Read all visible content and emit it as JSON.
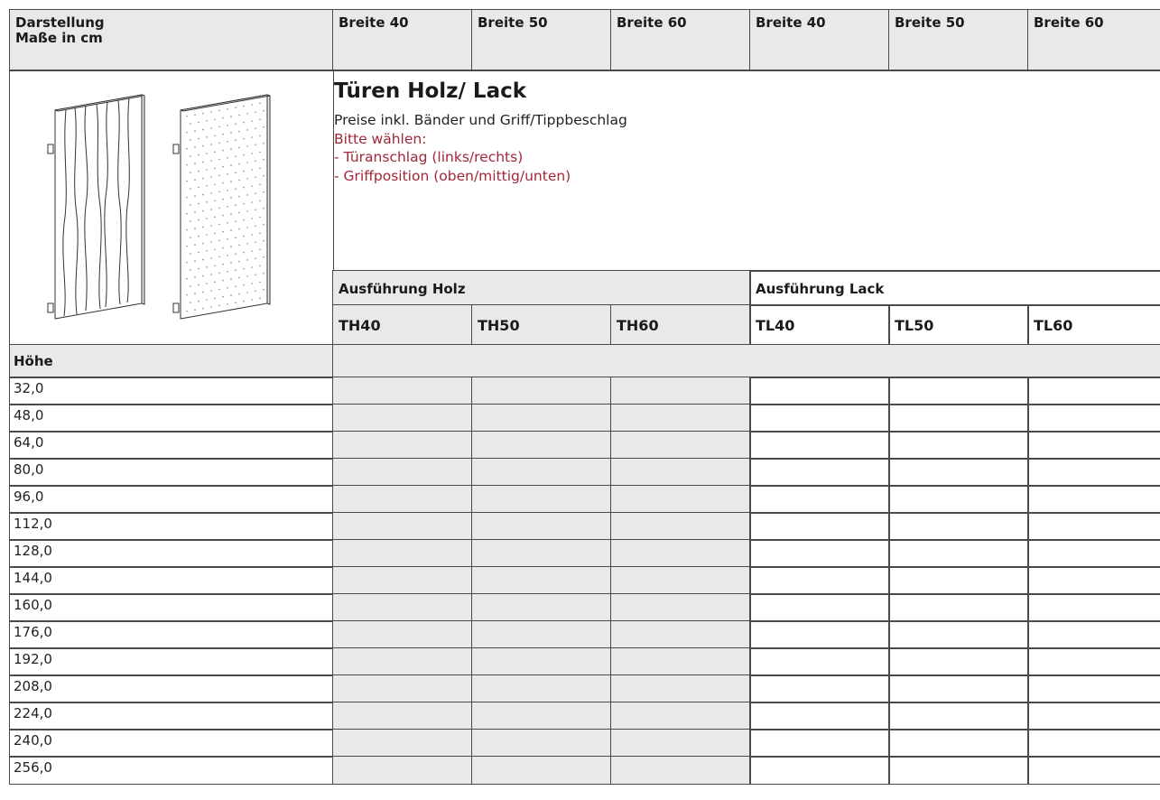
{
  "header": {
    "corner_line1": "Darstellung",
    "corner_line2": "Maße in cm",
    "widths": [
      "Breite 40",
      "Breite 50",
      "Breite 60",
      "Breite 40",
      "Breite 50",
      "Breite 60"
    ]
  },
  "product": {
    "title": "Türen Holz/ Lack",
    "subtitle": "Preise inkl. Bänder und Griff/Tippbeschlag",
    "choose": "Bitte wählen:",
    "option1": "- Türanschlag (links/rechts)",
    "option2": "- Griffposition (oben/mittig/unten)"
  },
  "groups": {
    "wood": "Ausführung Holz",
    "lacquer": "Ausführung Lack"
  },
  "codes": [
    "TH40",
    "TH50",
    "TH60",
    "TL40",
    "TL50",
    "TL60"
  ],
  "height_label": "Höhe",
  "heights": [
    "32,0",
    "48,0",
    "64,0",
    "80,0",
    "96,0",
    "112,0",
    "128,0",
    "144,0",
    "160,0",
    "176,0",
    "192,0",
    "208,0",
    "224,0",
    "240,0",
    "256,0"
  ],
  "colors": {
    "gray_fill": "#e9e9ea",
    "accent_red": "#a1273a",
    "border": "#4a4a4a"
  }
}
